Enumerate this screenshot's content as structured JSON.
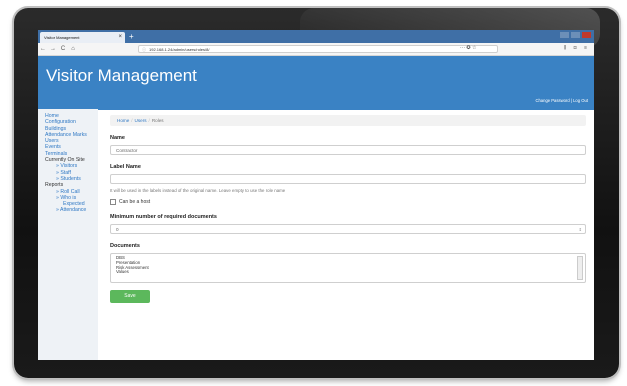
{
  "browser": {
    "tab_title": "Visitor Management",
    "tab_close": "×",
    "new_tab": "+",
    "nav_back": "←",
    "nav_forward": "→",
    "nav_reload": "C",
    "nav_home": "⌂",
    "url": "192.168.1.24/admin/users/roles/8/",
    "url_right_icons": "··· ✪ ☆",
    "toolbar_right": "⫼ ⊡ ≡"
  },
  "header": {
    "app_title": "Visitor Management",
    "change_password": "Change Password",
    "separator": "|",
    "log_out": "Log Out"
  },
  "sidebar": {
    "home": "Home",
    "configuration": "Configuration",
    "buildings": "Buildings",
    "attendance_marks": "Attendance Marks",
    "users": "Users",
    "events": "Events",
    "terminals": "Terminals",
    "currently_on_site": "Currently On Site",
    "visitors": "» Visitors",
    "staff": "» Staff",
    "students": "» Students",
    "reports": "Reports",
    "roll_call": "» Roll Call",
    "who_is": "» Who is",
    "expected": "Expected",
    "attendance": "» Attendance"
  },
  "breadcrumb": {
    "home": "Home",
    "users": "Users",
    "current": "Roles",
    "sep": "/"
  },
  "form": {
    "name_label": "Name",
    "name_value": "Contractor",
    "label_name_label": "Label Name",
    "label_name_value": "",
    "label_help": "It will be used in the labels instead of the original name. Leave empty to use the role name",
    "can_be_host_label": "Can be a host",
    "min_docs_label": "Minimum number of required documents",
    "min_docs_value": "0",
    "documents_label": "Documents",
    "documents_options": [
      "DBS",
      "Presentation",
      "Risk Assessment",
      "Values"
    ],
    "save_button": "Save"
  },
  "colors": {
    "header_bg": "#3a82c4",
    "link": "#2f78c4",
    "save_green": "#5cb85c",
    "sidebar_bg": "#eef2f6"
  }
}
